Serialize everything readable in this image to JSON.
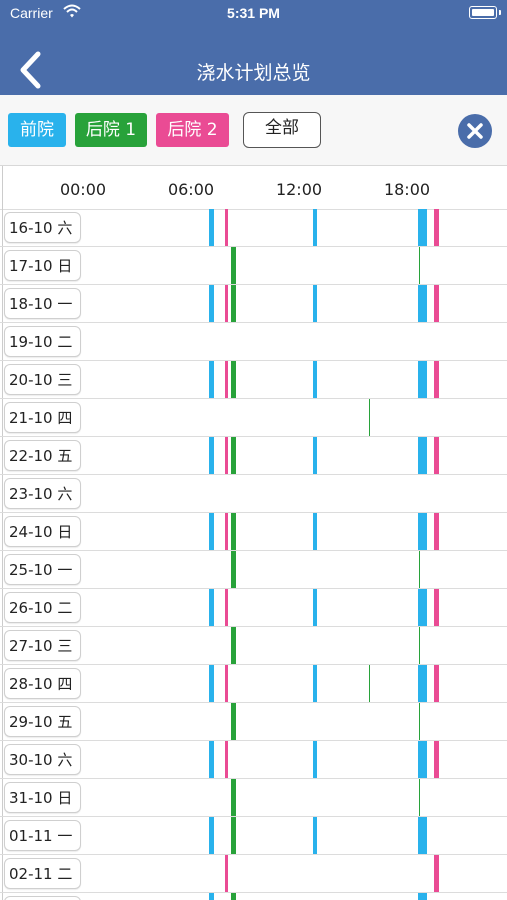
{
  "status_bar": {
    "carrier": "Carrier",
    "time": "5:31 PM"
  },
  "nav": {
    "title": "浇水计划总览"
  },
  "filters": [
    {
      "label": "前院",
      "color": "#29b2ec"
    },
    {
      "label": "后院 1",
      "color": "#28a23a"
    },
    {
      "label": "后院 2",
      "color": "#ea4b94"
    },
    {
      "label": "全部",
      "color": "#ffffff"
    }
  ],
  "axis": {
    "ticks": [
      {
        "label": "00:00",
        "hour": 0
      },
      {
        "label": "06:00",
        "hour": 6
      },
      {
        "label": "12:00",
        "hour": 12
      },
      {
        "label": "18:00",
        "hour": 18
      }
    ]
  },
  "colors": {
    "front": "#29b2ec",
    "back1": "#28a23a",
    "back2": "#ea4b94"
  },
  "rows": [
    {
      "date": "16-10 六",
      "events": [
        {
          "zone": "front",
          "start": 7.0,
          "duration": 0.3
        },
        {
          "zone": "back2",
          "start": 7.9,
          "duration": 0.15
        },
        {
          "zone": "front",
          "start": 12.75,
          "duration": 0.2
        },
        {
          "zone": "front",
          "start": 18.6,
          "duration": 0.5
        },
        {
          "zone": "back2",
          "start": 19.5,
          "duration": 0.3
        }
      ]
    },
    {
      "date": "17-10 日",
      "events": [
        {
          "zone": "back1",
          "start": 8.2,
          "duration": 0.3
        },
        {
          "zone": "back1",
          "start": 18.65,
          "duration": 0.05
        }
      ]
    },
    {
      "date": "18-10 一",
      "events": [
        {
          "zone": "front",
          "start": 7.0,
          "duration": 0.3
        },
        {
          "zone": "back2",
          "start": 7.9,
          "duration": 0.15
        },
        {
          "zone": "back1",
          "start": 8.2,
          "duration": 0.3
        },
        {
          "zone": "front",
          "start": 12.75,
          "duration": 0.2
        },
        {
          "zone": "front",
          "start": 18.6,
          "duration": 0.5
        },
        {
          "zone": "back2",
          "start": 19.5,
          "duration": 0.3
        }
      ]
    },
    {
      "date": "19-10 二",
      "events": []
    },
    {
      "date": "20-10 三",
      "events": [
        {
          "zone": "front",
          "start": 7.0,
          "duration": 0.3
        },
        {
          "zone": "back2",
          "start": 7.9,
          "duration": 0.15
        },
        {
          "zone": "back1",
          "start": 8.2,
          "duration": 0.3
        },
        {
          "zone": "front",
          "start": 12.75,
          "duration": 0.2
        },
        {
          "zone": "front",
          "start": 18.6,
          "duration": 0.5
        },
        {
          "zone": "back2",
          "start": 19.5,
          "duration": 0.3
        }
      ]
    },
    {
      "date": "21-10 四",
      "events": [
        {
          "zone": "back1",
          "start": 15.9,
          "duration": 0.05
        }
      ]
    },
    {
      "date": "22-10 五",
      "events": [
        {
          "zone": "front",
          "start": 7.0,
          "duration": 0.3
        },
        {
          "zone": "back2",
          "start": 7.9,
          "duration": 0.15
        },
        {
          "zone": "back1",
          "start": 8.2,
          "duration": 0.3
        },
        {
          "zone": "front",
          "start": 12.75,
          "duration": 0.2
        },
        {
          "zone": "front",
          "start": 18.6,
          "duration": 0.5
        },
        {
          "zone": "back2",
          "start": 19.5,
          "duration": 0.3
        }
      ]
    },
    {
      "date": "23-10 六",
      "events": []
    },
    {
      "date": "24-10 日",
      "events": [
        {
          "zone": "front",
          "start": 7.0,
          "duration": 0.3
        },
        {
          "zone": "back2",
          "start": 7.9,
          "duration": 0.15
        },
        {
          "zone": "back1",
          "start": 8.2,
          "duration": 0.3
        },
        {
          "zone": "front",
          "start": 12.75,
          "duration": 0.2
        },
        {
          "zone": "front",
          "start": 18.6,
          "duration": 0.5
        },
        {
          "zone": "back2",
          "start": 19.5,
          "duration": 0.3
        }
      ]
    },
    {
      "date": "25-10 一",
      "events": [
        {
          "zone": "back1",
          "start": 8.2,
          "duration": 0.3
        },
        {
          "zone": "back1",
          "start": 18.65,
          "duration": 0.05
        }
      ]
    },
    {
      "date": "26-10 二",
      "events": [
        {
          "zone": "front",
          "start": 7.0,
          "duration": 0.3
        },
        {
          "zone": "back2",
          "start": 7.9,
          "duration": 0.15
        },
        {
          "zone": "front",
          "start": 12.75,
          "duration": 0.2
        },
        {
          "zone": "front",
          "start": 18.6,
          "duration": 0.5
        },
        {
          "zone": "back2",
          "start": 19.5,
          "duration": 0.3
        }
      ]
    },
    {
      "date": "27-10 三",
      "events": [
        {
          "zone": "back1",
          "start": 8.2,
          "duration": 0.3
        },
        {
          "zone": "back1",
          "start": 18.65,
          "duration": 0.05
        }
      ]
    },
    {
      "date": "28-10 四",
      "events": [
        {
          "zone": "front",
          "start": 7.0,
          "duration": 0.3
        },
        {
          "zone": "back2",
          "start": 7.9,
          "duration": 0.15
        },
        {
          "zone": "front",
          "start": 12.75,
          "duration": 0.2
        },
        {
          "zone": "back1",
          "start": 15.9,
          "duration": 0.05
        },
        {
          "zone": "front",
          "start": 18.6,
          "duration": 0.5
        },
        {
          "zone": "back2",
          "start": 19.5,
          "duration": 0.3
        }
      ]
    },
    {
      "date": "29-10 五",
      "events": [
        {
          "zone": "back1",
          "start": 8.2,
          "duration": 0.3
        },
        {
          "zone": "back1",
          "start": 18.65,
          "duration": 0.05
        }
      ]
    },
    {
      "date": "30-10 六",
      "events": [
        {
          "zone": "front",
          "start": 7.0,
          "duration": 0.3
        },
        {
          "zone": "back2",
          "start": 7.9,
          "duration": 0.15
        },
        {
          "zone": "front",
          "start": 12.75,
          "duration": 0.2
        },
        {
          "zone": "front",
          "start": 18.6,
          "duration": 0.5
        },
        {
          "zone": "back2",
          "start": 19.5,
          "duration": 0.3
        }
      ]
    },
    {
      "date": "31-10 日",
      "events": [
        {
          "zone": "back1",
          "start": 8.2,
          "duration": 0.3
        },
        {
          "zone": "back1",
          "start": 18.65,
          "duration": 0.05
        }
      ]
    },
    {
      "date": "01-11 一",
      "events": [
        {
          "zone": "front",
          "start": 7.0,
          "duration": 0.3
        },
        {
          "zone": "back1",
          "start": 8.2,
          "duration": 0.3
        },
        {
          "zone": "front",
          "start": 12.75,
          "duration": 0.2
        },
        {
          "zone": "front",
          "start": 18.6,
          "duration": 0.5
        }
      ]
    },
    {
      "date": "02-11 二",
      "events": [
        {
          "zone": "back2",
          "start": 7.9,
          "duration": 0.15
        },
        {
          "zone": "back2",
          "start": 19.5,
          "duration": 0.3
        }
      ]
    },
    {
      "date": "",
      "events": [
        {
          "zone": "front",
          "start": 7.0,
          "duration": 0.3
        },
        {
          "zone": "back1",
          "start": 8.2,
          "duration": 0.3
        },
        {
          "zone": "front",
          "start": 18.6,
          "duration": 0.5
        }
      ]
    }
  ]
}
